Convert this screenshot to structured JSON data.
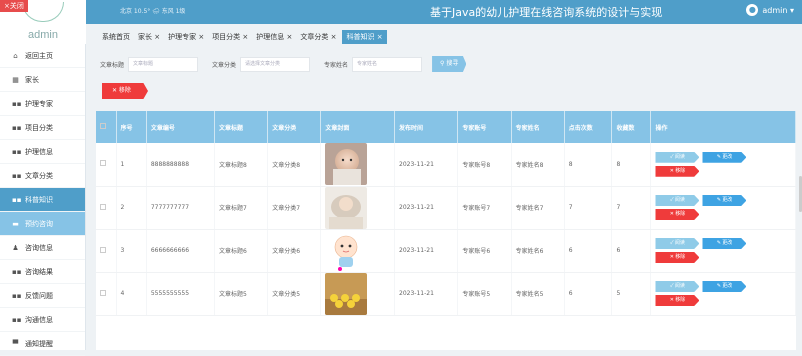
{
  "topbar": {
    "close_label": "×关闭",
    "logo_text": "admin",
    "weather": "北京  10.5°  🌧  东风  1级",
    "title": "基于Java的幼儿护理在线咨询系统的设计与实现",
    "user": "admin ▾",
    "avatar_char": "●"
  },
  "sidebar": {
    "items": [
      {
        "label": "返回主页",
        "icon": "home-icon",
        "glyph": "⌂"
      },
      {
        "label": "家长",
        "icon": "user-icon",
        "glyph": "▦"
      },
      {
        "label": "护理专家",
        "icon": "grid-icon",
        "glyph": "▪▪"
      },
      {
        "label": "项目分类",
        "icon": "grid-icon",
        "glyph": "▪▪"
      },
      {
        "label": "护理信息",
        "icon": "grid-icon",
        "glyph": "▪▪"
      },
      {
        "label": "文章分类",
        "icon": "grid-icon",
        "glyph": "▪▪"
      },
      {
        "label": "科普知识",
        "icon": "grid-icon",
        "glyph": "▪▪",
        "state": "active"
      },
      {
        "label": "预约咨询",
        "icon": "doc-icon",
        "glyph": "▬",
        "state": "hover"
      },
      {
        "label": "咨询信息",
        "icon": "person-icon",
        "glyph": "♟"
      },
      {
        "label": "咨询结果",
        "icon": "grid-icon",
        "glyph": "▪▪"
      },
      {
        "label": "反馈问题",
        "icon": "grid-icon",
        "glyph": "▪▪"
      },
      {
        "label": "沟通信息",
        "icon": "grid-icon",
        "glyph": "▪▪"
      },
      {
        "label": "通知提醒",
        "icon": "bell-icon",
        "glyph": "▀"
      }
    ]
  },
  "tabs": [
    {
      "label": "系统首页",
      "closable": false
    },
    {
      "label": "家长 ×",
      "closable": true
    },
    {
      "label": "护理专家 ×",
      "closable": true
    },
    {
      "label": "项目分类 ×",
      "closable": true
    },
    {
      "label": "护理信息 ×",
      "closable": true
    },
    {
      "label": "文章分类 ×",
      "closable": true
    },
    {
      "label": "科普知识 ×",
      "closable": true,
      "active": true
    }
  ],
  "search": {
    "title_label": "文章标题",
    "title_placeholder": "文章标题",
    "category_label": "文章分类",
    "category_placeholder": "请选择文章分类",
    "expert_label": "专家姓名",
    "expert_placeholder": "专家姓名",
    "search_button": "⚲ 搜寻"
  },
  "actions": {
    "remove_button": "✕  移除"
  },
  "table": {
    "headers": [
      "",
      "序号",
      "文章编号",
      "文章标题",
      "文章分类",
      "文章封面",
      "发布时间",
      "专家账号",
      "专家姓名",
      "点击次数",
      "收藏数",
      "操作"
    ],
    "rows": [
      {
        "index": "1",
        "code": "8888888888",
        "title": "文章标题8",
        "category": "文章分类8",
        "cover": "baby-photo",
        "time": "2023-11-21",
        "account": "专家账号8",
        "name": "专家姓名8",
        "clicks": "8",
        "favorites": "8"
      },
      {
        "index": "2",
        "code": "7777777777",
        "title": "文章标题7",
        "category": "文章分类7",
        "cover": "baby-sleeping-photo",
        "time": "2023-11-21",
        "account": "专家账号7",
        "name": "专家姓名7",
        "clicks": "7",
        "favorites": "7"
      },
      {
        "index": "3",
        "code": "6666666666",
        "title": "文章标题6",
        "category": "文章分类6",
        "cover": "cartoon-baby-illustration",
        "time": "2023-11-21",
        "account": "专家账号6",
        "name": "专家姓名6",
        "clicks": "6",
        "favorites": "6"
      },
      {
        "index": "4",
        "code": "5555555555",
        "title": "文章标题5",
        "category": "文章分类5",
        "cover": "toy-ducks-photo",
        "time": "2023-11-21",
        "account": "专家账号5",
        "name": "专家姓名5",
        "clicks": "6",
        "favorites": "5"
      }
    ],
    "op_labels": {
      "read": "✓  阅读",
      "edit": "✎  更改",
      "delete": "✕  移除"
    }
  },
  "colors": {
    "primary": "#4f9ec9",
    "header_row": "#86c3e6",
    "danger": "#ef3b3b",
    "edit": "#3ea3e3"
  }
}
